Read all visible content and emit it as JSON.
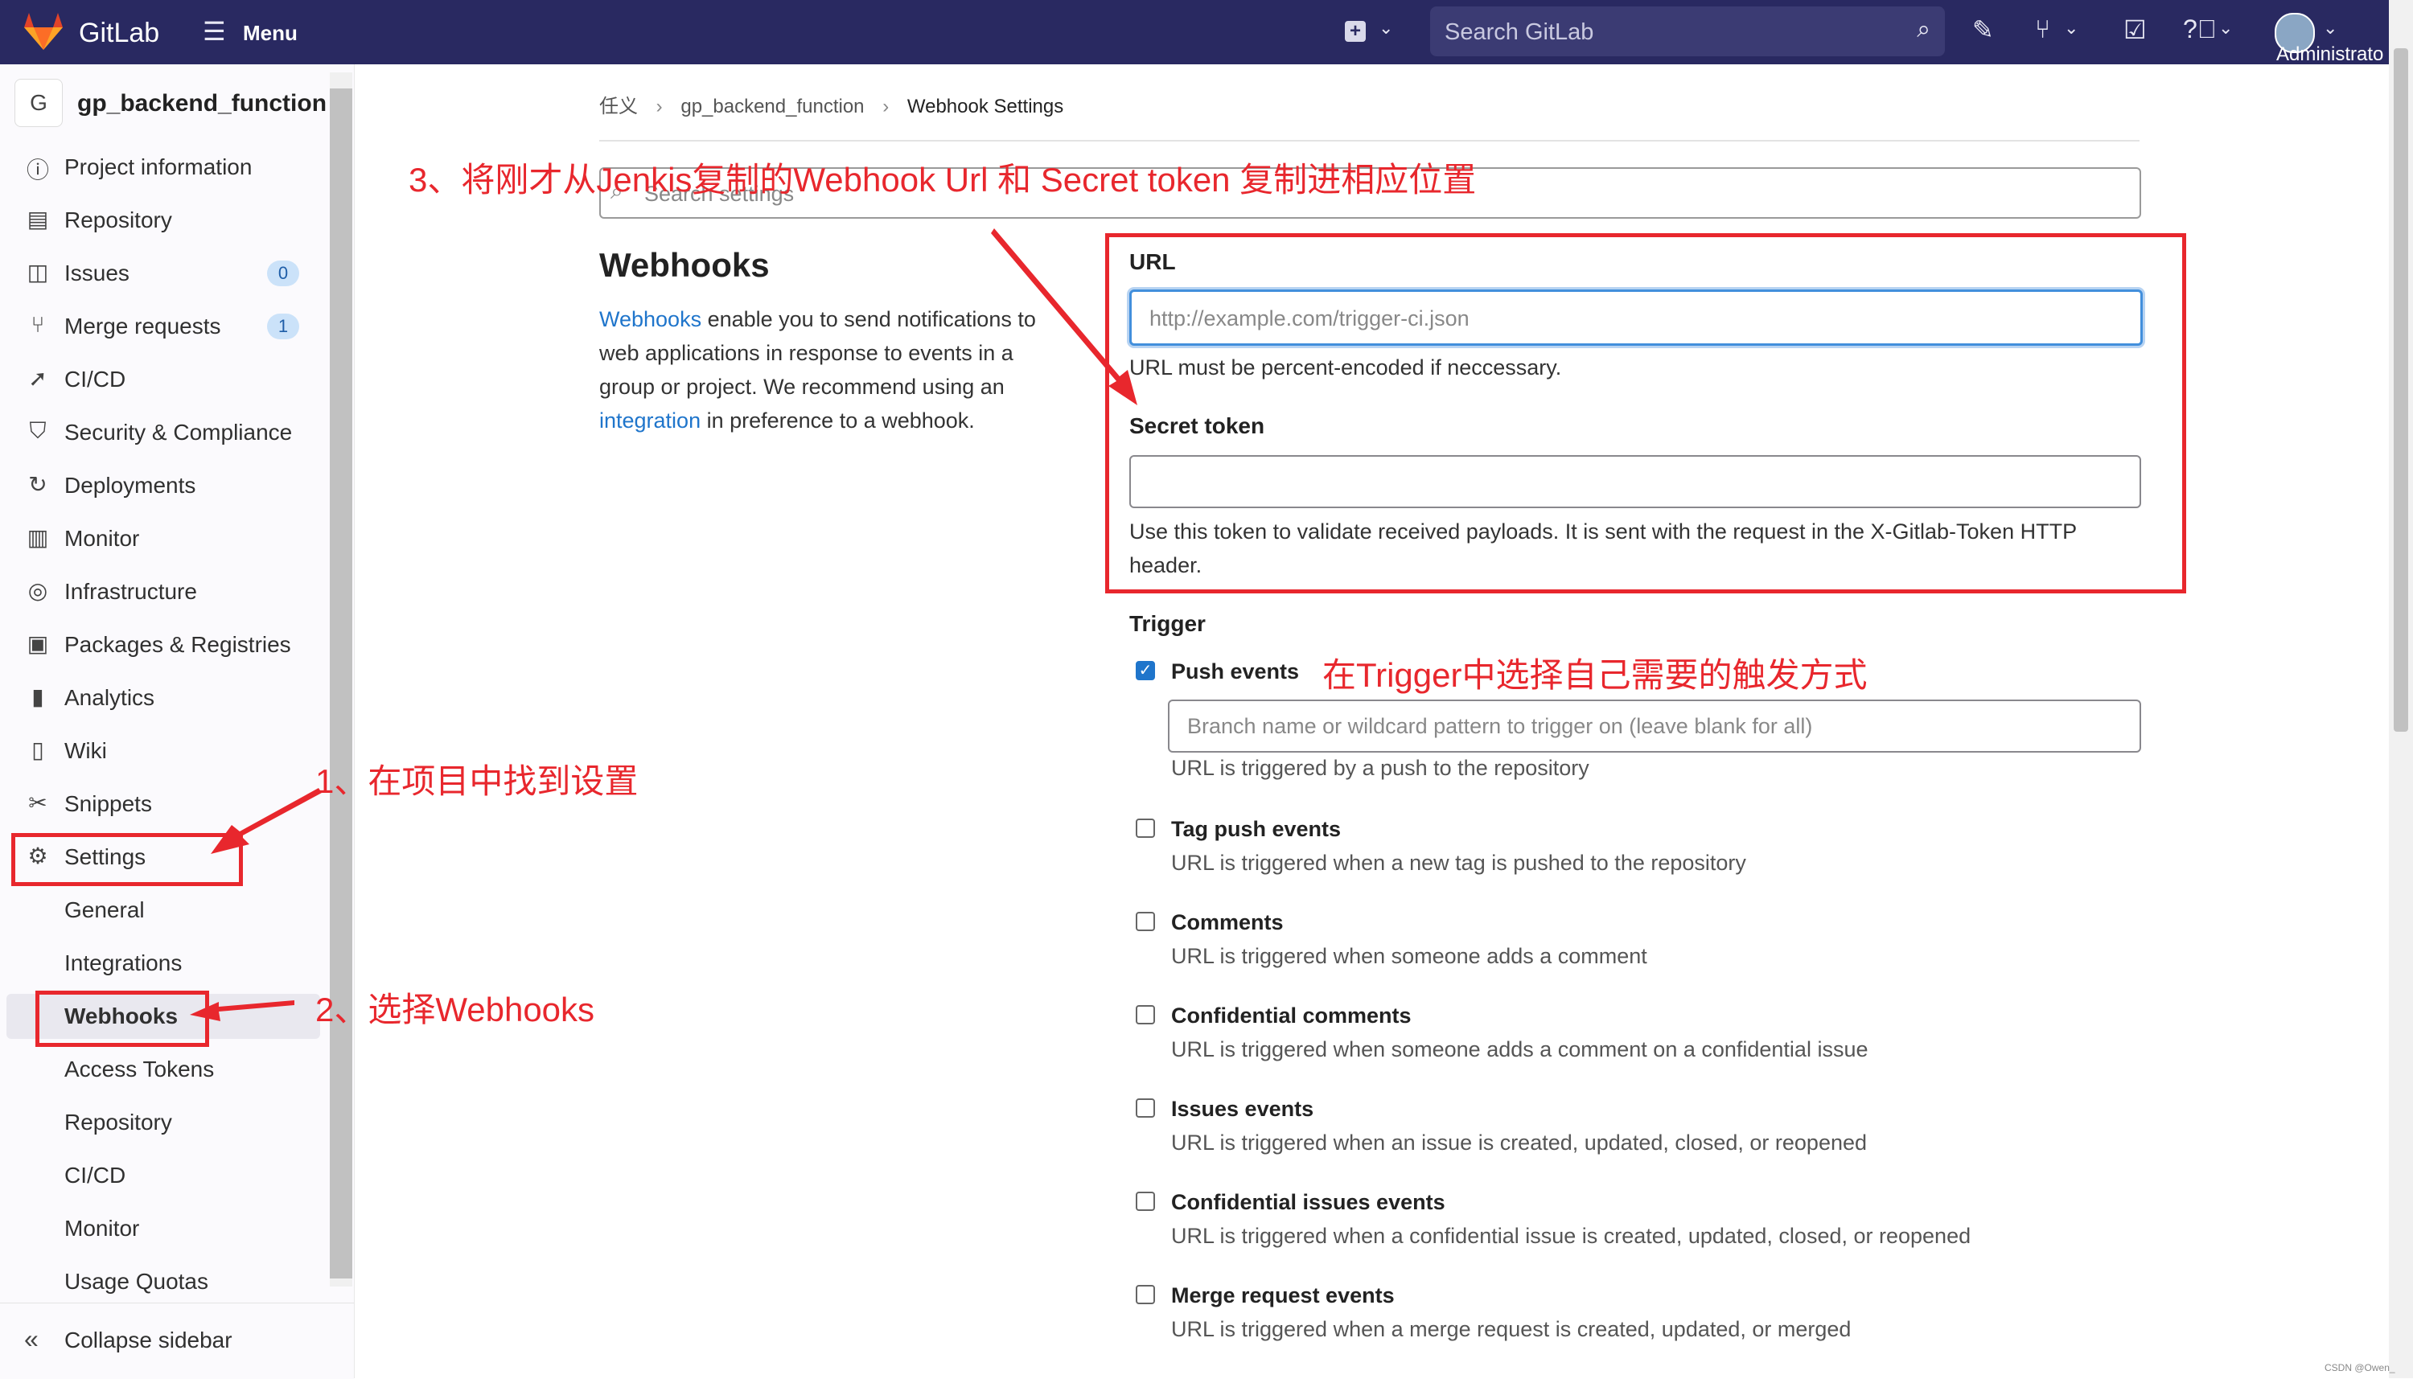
{
  "topbar": {
    "brand": "GitLab",
    "menu_label": "Menu",
    "search_placeholder": "Search GitLab",
    "user_label": "Administrato"
  },
  "sidebar": {
    "project_avatar": "G",
    "project_name": "gp_backend_function",
    "items": [
      {
        "label": "Project information",
        "icon": "info-icon"
      },
      {
        "label": "Repository",
        "icon": "document-icon"
      },
      {
        "label": "Issues",
        "icon": "issues-icon",
        "badge": "0"
      },
      {
        "label": "Merge requests",
        "icon": "merge-request-icon",
        "badge": "1"
      },
      {
        "label": "CI/CD",
        "icon": "rocket-icon"
      },
      {
        "label": "Security & Compliance",
        "icon": "shield-icon"
      },
      {
        "label": "Deployments",
        "icon": "deployments-icon"
      },
      {
        "label": "Monitor",
        "icon": "monitor-icon"
      },
      {
        "label": "Infrastructure",
        "icon": "infrastructure-icon"
      },
      {
        "label": "Packages & Registries",
        "icon": "package-icon"
      },
      {
        "label": "Analytics",
        "icon": "chart-icon"
      },
      {
        "label": "Wiki",
        "icon": "book-icon"
      },
      {
        "label": "Snippets",
        "icon": "scissors-icon"
      },
      {
        "label": "Settings",
        "icon": "gear-icon"
      }
    ],
    "settings_sub": [
      "General",
      "Integrations",
      "Webhooks",
      "Access Tokens",
      "Repository",
      "CI/CD",
      "Monitor",
      "Usage Quotas"
    ],
    "collapse_label": "Collapse sidebar"
  },
  "breadcrumb": [
    "任义",
    "gp_backend_function",
    "Webhook Settings"
  ],
  "search_settings_placeholder": "Search settings",
  "webhooks": {
    "title": "Webhooks",
    "desc_link1": "Webhooks",
    "desc_part1": " enable you to send notifications to web applications in response to events in a group or project. We recommend using an ",
    "desc_link2": "integration",
    "desc_part2": " in preference to a webhook."
  },
  "form": {
    "url_label": "URL",
    "url_placeholder": "http://example.com/trigger-ci.json",
    "url_help": "URL must be percent-encoded if neccessary.",
    "secret_label": "Secret token",
    "secret_help": "Use this token to validate received payloads. It is sent with the request in the X-Gitlab-Token HTTP header.",
    "trigger_label": "Trigger",
    "branch_placeholder": "Branch name or wildcard pattern to trigger on (leave blank for all)",
    "triggers": [
      {
        "label": "Push events",
        "help": "URL is triggered by a push to the repository",
        "checked": true
      },
      {
        "label": "Tag push events",
        "help": "URL is triggered when a new tag is pushed to the repository",
        "checked": false
      },
      {
        "label": "Comments",
        "help": "URL is triggered when someone adds a comment",
        "checked": false
      },
      {
        "label": "Confidential comments",
        "help": "URL is triggered when someone adds a comment on a confidential issue",
        "checked": false
      },
      {
        "label": "Issues events",
        "help": "URL is triggered when an issue is created, updated, closed, or reopened",
        "checked": false
      },
      {
        "label": "Confidential issues events",
        "help": "URL is triggered when a confidential issue is created, updated, closed, or reopened",
        "checked": false
      },
      {
        "label": "Merge request events",
        "help": "URL is triggered when a merge request is created, updated, or merged",
        "checked": false
      }
    ]
  },
  "annotations": {
    "step1": "1、在项目中找到设置",
    "step2": "2、选择Webhooks",
    "step3": "3、将刚才从Jenkis复制的Webhook Url 和 Secret token 复制进相应位置",
    "trigger_note": "在Trigger中选择自己需要的触发方式"
  },
  "watermark": "CSDN @Owen_",
  "colors": {
    "topbar": "#292961",
    "link": "#1f75cb",
    "annotation": "#e8272d"
  }
}
